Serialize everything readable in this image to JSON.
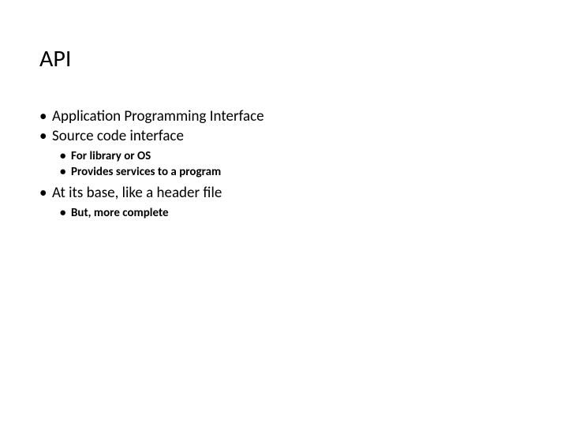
{
  "title": "API",
  "bullets": {
    "b1": "Application Programming Interface",
    "b2": "Source code interface",
    "b2_sub": {
      "s1": "For library or OS",
      "s2": "Provides services to a program"
    },
    "b3": "At its base, like a header file",
    "b3_sub": {
      "s1": "But, more complete"
    }
  }
}
